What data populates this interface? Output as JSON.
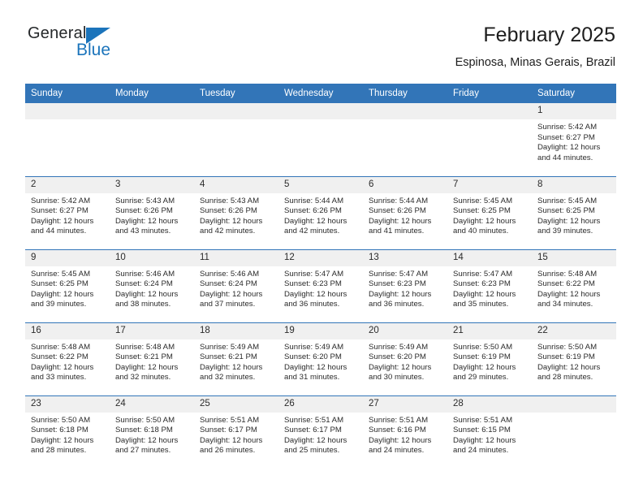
{
  "brand": {
    "name_part1": "General",
    "name_part2": "Blue",
    "triangle_color": "#1b74bb"
  },
  "header": {
    "title": "February 2025",
    "subtitle": "Espinosa, Minas Gerais, Brazil"
  },
  "colors": {
    "header_blue": "#3275b8",
    "daynum_bg": "#f0f0f0",
    "text": "#2b2b2b"
  },
  "weekday_headers": [
    "Sunday",
    "Monday",
    "Tuesday",
    "Wednesday",
    "Thursday",
    "Friday",
    "Saturday"
  ],
  "labels": {
    "sunrise_prefix": "Sunrise:",
    "sunset_prefix": "Sunset:",
    "daylight_prefix": "Daylight:"
  },
  "weeks": [
    [
      {
        "day": "",
        "empty": true
      },
      {
        "day": "",
        "empty": true
      },
      {
        "day": "",
        "empty": true
      },
      {
        "day": "",
        "empty": true
      },
      {
        "day": "",
        "empty": true
      },
      {
        "day": "",
        "empty": true
      },
      {
        "day": "1",
        "sunrise": "Sunrise: 5:42 AM",
        "sunset": "Sunset: 6:27 PM",
        "daylight": "Daylight: 12 hours and 44 minutes."
      }
    ],
    [
      {
        "day": "2",
        "sunrise": "Sunrise: 5:42 AM",
        "sunset": "Sunset: 6:27 PM",
        "daylight": "Daylight: 12 hours and 44 minutes."
      },
      {
        "day": "3",
        "sunrise": "Sunrise: 5:43 AM",
        "sunset": "Sunset: 6:26 PM",
        "daylight": "Daylight: 12 hours and 43 minutes."
      },
      {
        "day": "4",
        "sunrise": "Sunrise: 5:43 AM",
        "sunset": "Sunset: 6:26 PM",
        "daylight": "Daylight: 12 hours and 42 minutes."
      },
      {
        "day": "5",
        "sunrise": "Sunrise: 5:44 AM",
        "sunset": "Sunset: 6:26 PM",
        "daylight": "Daylight: 12 hours and 42 minutes."
      },
      {
        "day": "6",
        "sunrise": "Sunrise: 5:44 AM",
        "sunset": "Sunset: 6:26 PM",
        "daylight": "Daylight: 12 hours and 41 minutes."
      },
      {
        "day": "7",
        "sunrise": "Sunrise: 5:45 AM",
        "sunset": "Sunset: 6:25 PM",
        "daylight": "Daylight: 12 hours and 40 minutes."
      },
      {
        "day": "8",
        "sunrise": "Sunrise: 5:45 AM",
        "sunset": "Sunset: 6:25 PM",
        "daylight": "Daylight: 12 hours and 39 minutes."
      }
    ],
    [
      {
        "day": "9",
        "sunrise": "Sunrise: 5:45 AM",
        "sunset": "Sunset: 6:25 PM",
        "daylight": "Daylight: 12 hours and 39 minutes."
      },
      {
        "day": "10",
        "sunrise": "Sunrise: 5:46 AM",
        "sunset": "Sunset: 6:24 PM",
        "daylight": "Daylight: 12 hours and 38 minutes."
      },
      {
        "day": "11",
        "sunrise": "Sunrise: 5:46 AM",
        "sunset": "Sunset: 6:24 PM",
        "daylight": "Daylight: 12 hours and 37 minutes."
      },
      {
        "day": "12",
        "sunrise": "Sunrise: 5:47 AM",
        "sunset": "Sunset: 6:23 PM",
        "daylight": "Daylight: 12 hours and 36 minutes."
      },
      {
        "day": "13",
        "sunrise": "Sunrise: 5:47 AM",
        "sunset": "Sunset: 6:23 PM",
        "daylight": "Daylight: 12 hours and 36 minutes."
      },
      {
        "day": "14",
        "sunrise": "Sunrise: 5:47 AM",
        "sunset": "Sunset: 6:23 PM",
        "daylight": "Daylight: 12 hours and 35 minutes."
      },
      {
        "day": "15",
        "sunrise": "Sunrise: 5:48 AM",
        "sunset": "Sunset: 6:22 PM",
        "daylight": "Daylight: 12 hours and 34 minutes."
      }
    ],
    [
      {
        "day": "16",
        "sunrise": "Sunrise: 5:48 AM",
        "sunset": "Sunset: 6:22 PM",
        "daylight": "Daylight: 12 hours and 33 minutes."
      },
      {
        "day": "17",
        "sunrise": "Sunrise: 5:48 AM",
        "sunset": "Sunset: 6:21 PM",
        "daylight": "Daylight: 12 hours and 32 minutes."
      },
      {
        "day": "18",
        "sunrise": "Sunrise: 5:49 AM",
        "sunset": "Sunset: 6:21 PM",
        "daylight": "Daylight: 12 hours and 32 minutes."
      },
      {
        "day": "19",
        "sunrise": "Sunrise: 5:49 AM",
        "sunset": "Sunset: 6:20 PM",
        "daylight": "Daylight: 12 hours and 31 minutes."
      },
      {
        "day": "20",
        "sunrise": "Sunrise: 5:49 AM",
        "sunset": "Sunset: 6:20 PM",
        "daylight": "Daylight: 12 hours and 30 minutes."
      },
      {
        "day": "21",
        "sunrise": "Sunrise: 5:50 AM",
        "sunset": "Sunset: 6:19 PM",
        "daylight": "Daylight: 12 hours and 29 minutes."
      },
      {
        "day": "22",
        "sunrise": "Sunrise: 5:50 AM",
        "sunset": "Sunset: 6:19 PM",
        "daylight": "Daylight: 12 hours and 28 minutes."
      }
    ],
    [
      {
        "day": "23",
        "sunrise": "Sunrise: 5:50 AM",
        "sunset": "Sunset: 6:18 PM",
        "daylight": "Daylight: 12 hours and 28 minutes."
      },
      {
        "day": "24",
        "sunrise": "Sunrise: 5:50 AM",
        "sunset": "Sunset: 6:18 PM",
        "daylight": "Daylight: 12 hours and 27 minutes."
      },
      {
        "day": "25",
        "sunrise": "Sunrise: 5:51 AM",
        "sunset": "Sunset: 6:17 PM",
        "daylight": "Daylight: 12 hours and 26 minutes."
      },
      {
        "day": "26",
        "sunrise": "Sunrise: 5:51 AM",
        "sunset": "Sunset: 6:17 PM",
        "daylight": "Daylight: 12 hours and 25 minutes."
      },
      {
        "day": "27",
        "sunrise": "Sunrise: 5:51 AM",
        "sunset": "Sunset: 6:16 PM",
        "daylight": "Daylight: 12 hours and 24 minutes."
      },
      {
        "day": "28",
        "sunrise": "Sunrise: 5:51 AM",
        "sunset": "Sunset: 6:15 PM",
        "daylight": "Daylight: 12 hours and 24 minutes."
      },
      {
        "day": "",
        "empty": true
      }
    ]
  ]
}
